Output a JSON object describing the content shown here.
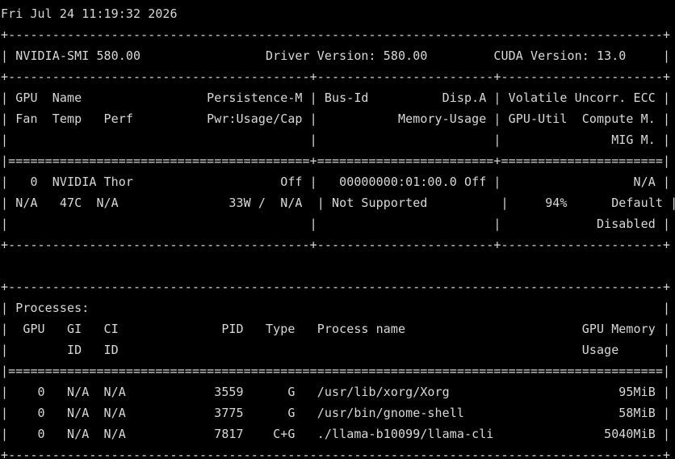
{
  "terminal": {
    "lines": [
      "Fri Jul 24 11:19:32 2026",
      "+-----------------------------------------------------------------------------------------+",
      "| NVIDIA-SMI 580.00                 Driver Version: 580.00         CUDA Version: 13.0     |",
      "+-----------------------------------------+------------------------+----------------------+",
      "| GPU  Name                 Persistence-M | Bus-Id          Disp.A | Volatile Uncorr. ECC |",
      "| Fan  Temp   Perf          Pwr:Usage/Cap |           Memory-Usage | GPU-Util  Compute M. |",
      "|                                         |                        |               MIG M. |",
      "|=========================================+========================+======================|",
      "|   0  NVIDIA Thor                    Off |   00000000:01:00.0 Off |                  N/A |",
      "| N/A   47C  N/A               33W /  N/A  | Not Supported          |     94%      Default |",
      "|                                         |                        |             Disabled |",
      "+-----------------------------------------+------------------------+----------------------+",
      "",
      "+-----------------------------------------------------------------------------------------+",
      "| Processes:                                                                              |",
      "|  GPU   GI   CI              PID   Type   Process name                        GPU Memory |",
      "|        ID   ID                                                               Usage      |",
      "|=========================================================================================|",
      "|    0   N/A  N/A            3559      G   /usr/lib/xorg/Xorg                       95MiB |",
      "|    0   N/A  N/A            3775      G   /usr/bin/gnome-shell                     58MiB |",
      "|    0   N/A  N/A            7817    C+G   ./llama-b10099/llama-cli               5040MiB |",
      "+-----------------------------------------------------------------------------------------+"
    ]
  },
  "colors": {
    "background": "#000000",
    "foreground": "#d8d8d8"
  }
}
